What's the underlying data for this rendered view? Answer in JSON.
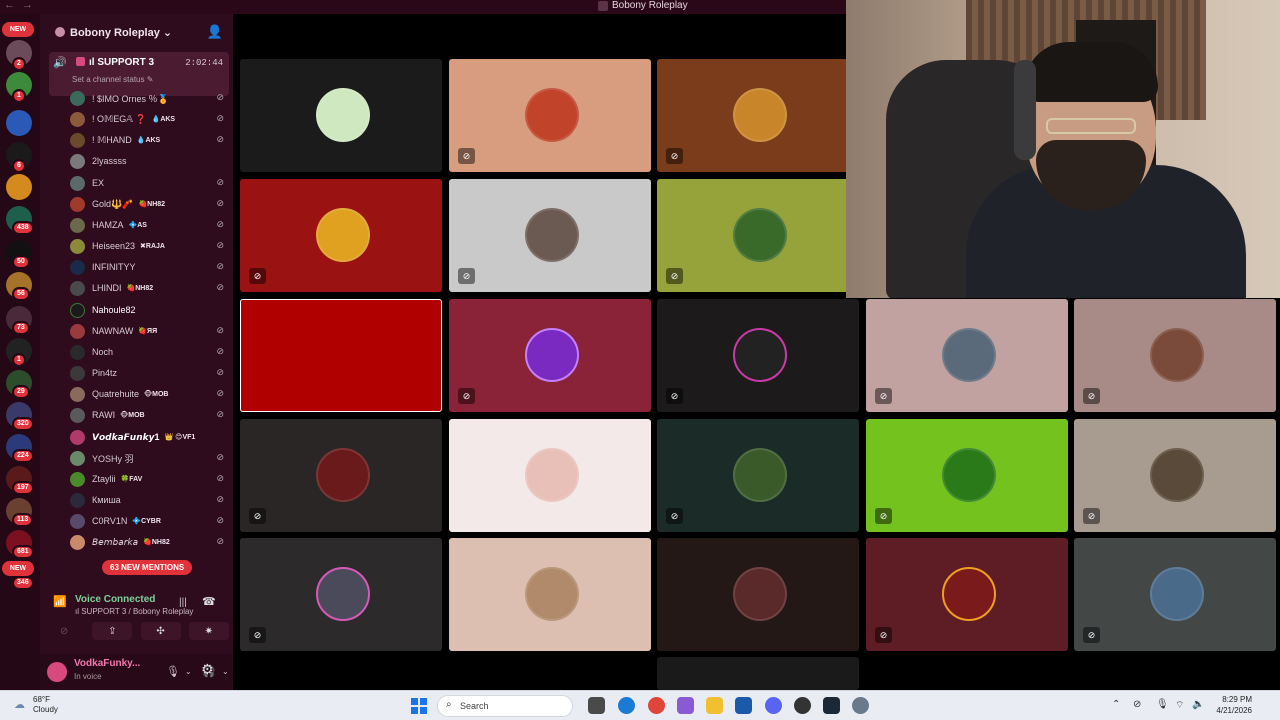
{
  "window": {
    "title": "Bobony Roleplay",
    "nav": "← →"
  },
  "rail": {
    "top_pill": "NEW",
    "bottom_pill": "NEW",
    "badges": [
      "2",
      "1",
      "6",
      "438",
      "50",
      "56",
      "73",
      "1",
      "29",
      "320",
      "224",
      "197",
      "113",
      "681",
      "346"
    ]
  },
  "server": {
    "name": "Bobony Roleplay ⌄"
  },
  "voice_channel": {
    "name": "ıl SUPPORT 3",
    "timer": "2:02:44",
    "status_prompt": "Set a channel status ✎"
  },
  "users": [
    {
      "name": "! $IMO Ornes ％🏅",
      "tag": ""
    },
    {
      "name": "! O𝕄EG𝔸 ❓",
      "tag": "💧AKS"
    },
    {
      "name": "! 𝕄HAND",
      "tag": "💧AKS"
    },
    {
      "name": "2lyassss",
      "tag": ""
    },
    {
      "name": "EX",
      "tag": ""
    },
    {
      "name": "Gold🔱🧨",
      "tag": "🍓NH82"
    },
    {
      "name": "HAMZA",
      "tag": "💠AS"
    },
    {
      "name": "Heiseen23",
      "tag": "✖RAJA"
    },
    {
      "name": "INFINITYY",
      "tag": ""
    },
    {
      "name": "LHINDI",
      "tag": "🍓NH82"
    },
    {
      "name": "Nahoule82",
      "tag": ""
    },
    {
      "name": "NAWNAW",
      "tag": "🍓ЯЯ"
    },
    {
      "name": "Noch",
      "tag": ""
    },
    {
      "name": "Pin4tz",
      "tag": ""
    },
    {
      "name": "Quatrehuite",
      "tag": "🐵MOB"
    },
    {
      "name": "RAWI",
      "tag": "🐵MOB"
    },
    {
      "name": "𝙑𝙤𝙙𝙠𝙖𝙁𝙪𝙣𝙠𝙮1",
      "tag": "👑 😊VF1"
    },
    {
      "name": "YOSHy 羽",
      "tag": ""
    },
    {
      "name": "Ztaylii",
      "tag": "🍀FAV"
    },
    {
      "name": "Кмиша",
      "tag": ""
    },
    {
      "name": "C0RV1N",
      "tag": "💠CYBR"
    },
    {
      "name": "𝘉𝘦𝘮𝘣𝘢𝘳𝘬𝘢",
      "tag": "🍓NH82"
    }
  ],
  "mentions": "63 NEW MENTIONS",
  "voice_panel": {
    "connected": "Voice Connected",
    "channel": "ıl SUPPORT 3 / Bobony Roleplay"
  },
  "user_bar": {
    "name": "VodkaFunky...",
    "status": "In voice"
  },
  "taskbar": {
    "temp": "68°F",
    "condition": "Cloudy",
    "search": "Search",
    "time": "8:29 PM",
    "date": "4/21/2026"
  },
  "colors": {
    "accent": "#e0323b",
    "sidebar": "#2f0b1e",
    "voice_green": "#3ba55d"
  }
}
